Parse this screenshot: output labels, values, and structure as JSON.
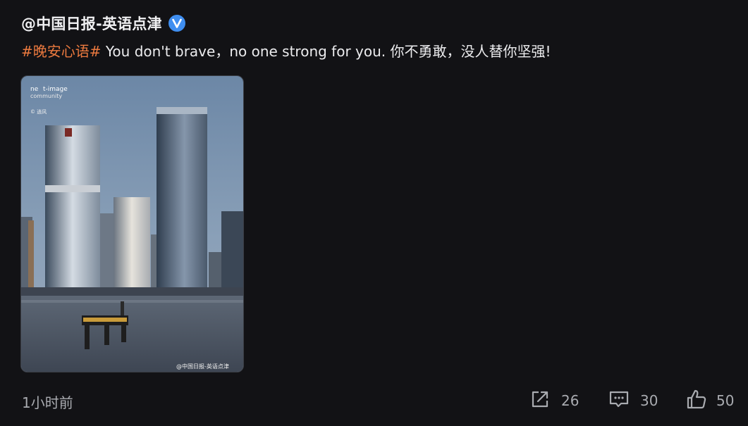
{
  "post": {
    "author": "@中国日报-英语点津",
    "verified_icon": "verified-badge-icon",
    "hashtag": "#晚安心语#",
    "text": " You don't brave，no one strong for you. 你不勇敢，没人替你坚强!",
    "image": {
      "watermark_brand_top": "ne",
      "watermark_brand_bottom": "t-image",
      "watermark_community": "community",
      "watermark_credit": "© 逍风",
      "watermark_weibo": "@中国日报-英语点津"
    },
    "timestamp": "1小时前",
    "actions": {
      "share": {
        "icon": "share-icon",
        "count": "26"
      },
      "comment": {
        "icon": "comment-icon",
        "count": "30"
      },
      "like": {
        "icon": "thumbs-up-icon",
        "count": "50"
      }
    }
  },
  "colors": {
    "background": "#121215",
    "hashtag": "#ec7a3f",
    "verified": "#3f8ef0",
    "muted_text": "#a9abb0"
  }
}
